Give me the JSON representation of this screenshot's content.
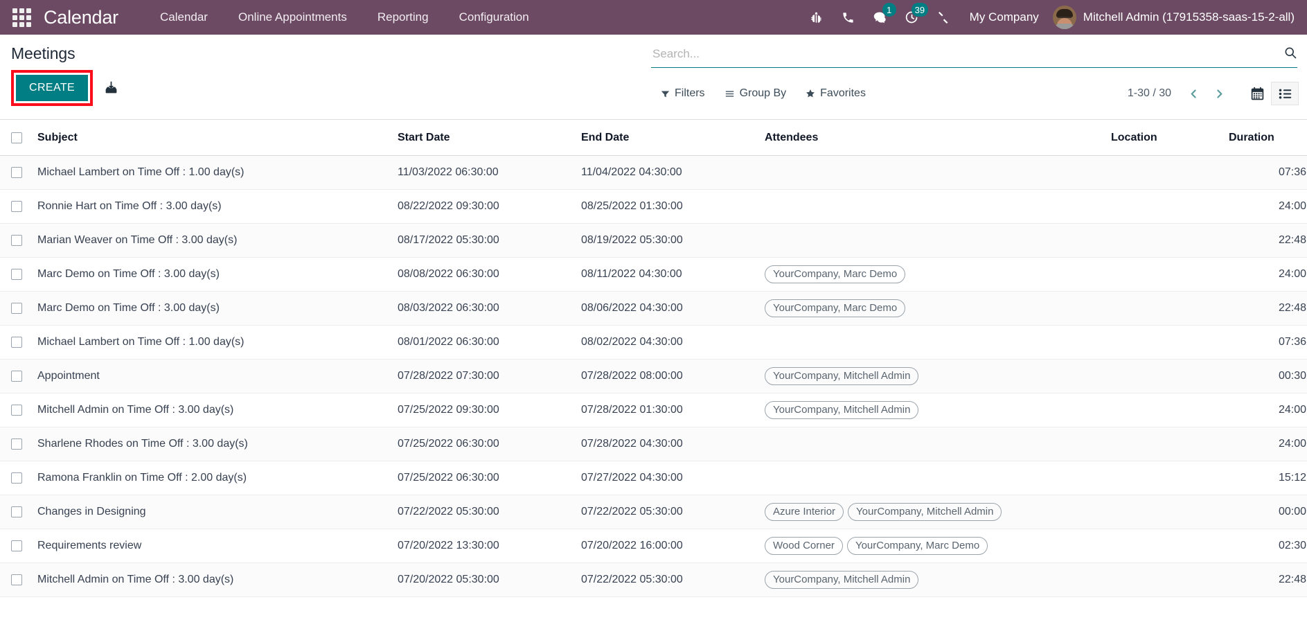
{
  "navbar": {
    "apps_icon": "apps-grid-icon",
    "brand": "Calendar",
    "menu": [
      {
        "label": "Calendar"
      },
      {
        "label": "Online Appointments"
      },
      {
        "label": "Reporting"
      },
      {
        "label": "Configuration"
      }
    ],
    "sys_icons": [
      {
        "name": "bug-icon",
        "badge": ""
      },
      {
        "name": "phone-icon",
        "badge": ""
      },
      {
        "name": "messages-icon",
        "badge": "1"
      },
      {
        "name": "activities-clock-icon",
        "badge": "39"
      },
      {
        "name": "tools-icon",
        "badge": ""
      }
    ],
    "company": "My Company",
    "user": "Mitchell Admin (17915358-saas-15-2-all)",
    "bg_color": "#6c4a63"
  },
  "control_panel": {
    "title": "Meetings",
    "create_label": "CREATE",
    "create_bg": "#017e84",
    "highlight_color": "#fc0d1b",
    "import_icon": "import-download-icon",
    "search": {
      "placeholder": "Search...",
      "value": ""
    },
    "filters": [
      {
        "label": "Filters",
        "icon": "filter-caret-icon"
      },
      {
        "label": "Group By",
        "icon": "group-lines-icon"
      },
      {
        "label": "Favorites",
        "icon": "star-icon"
      }
    ],
    "pager": "1-30 / 30",
    "prev_icon": "chevron-left-icon",
    "next_icon": "chevron-right-icon",
    "views": [
      {
        "name": "calendar-view",
        "icon": "calendar-icon",
        "active": false
      },
      {
        "name": "list-view",
        "icon": "list-icon",
        "active": true
      }
    ]
  },
  "table": {
    "columns": [
      "Subject",
      "Start Date",
      "End Date",
      "Attendees",
      "Location",
      "Duration"
    ],
    "optional_columns_icon": "vertical-dots-icon",
    "rows": [
      {
        "subject": "Michael Lambert on Time Off : 1.00 day(s)",
        "start": "11/03/2022 06:30:00",
        "end": "11/04/2022 04:30:00",
        "attendees": [],
        "location": "",
        "duration": "07:36"
      },
      {
        "subject": "Ronnie Hart on Time Off : 3.00 day(s)",
        "start": "08/22/2022 09:30:00",
        "end": "08/25/2022 01:30:00",
        "attendees": [],
        "location": "",
        "duration": "24:00"
      },
      {
        "subject": "Marian Weaver on Time Off : 3.00 day(s)",
        "start": "08/17/2022 05:30:00",
        "end": "08/19/2022 05:30:00",
        "attendees": [],
        "location": "",
        "duration": "22:48"
      },
      {
        "subject": "Marc Demo on Time Off : 3.00 day(s)",
        "start": "08/08/2022 06:30:00",
        "end": "08/11/2022 04:30:00",
        "attendees": [
          "YourCompany, Marc Demo"
        ],
        "location": "",
        "duration": "24:00"
      },
      {
        "subject": "Marc Demo on Time Off : 3.00 day(s)",
        "start": "08/03/2022 06:30:00",
        "end": "08/06/2022 04:30:00",
        "attendees": [
          "YourCompany, Marc Demo"
        ],
        "location": "",
        "duration": "22:48"
      },
      {
        "subject": "Michael Lambert on Time Off : 1.00 day(s)",
        "start": "08/01/2022 06:30:00",
        "end": "08/02/2022 04:30:00",
        "attendees": [],
        "location": "",
        "duration": "07:36"
      },
      {
        "subject": "Appointment",
        "start": "07/28/2022 07:30:00",
        "end": "07/28/2022 08:00:00",
        "attendees": [
          "YourCompany, Mitchell Admin"
        ],
        "location": "",
        "duration": "00:30"
      },
      {
        "subject": "Mitchell Admin on Time Off : 3.00 day(s)",
        "start": "07/25/2022 09:30:00",
        "end": "07/28/2022 01:30:00",
        "attendees": [
          "YourCompany, Mitchell Admin"
        ],
        "location": "",
        "duration": "24:00"
      },
      {
        "subject": "Sharlene Rhodes on Time Off : 3.00 day(s)",
        "start": "07/25/2022 06:30:00",
        "end": "07/28/2022 04:30:00",
        "attendees": [],
        "location": "",
        "duration": "24:00"
      },
      {
        "subject": "Ramona Franklin on Time Off : 2.00 day(s)",
        "start": "07/25/2022 06:30:00",
        "end": "07/27/2022 04:30:00",
        "attendees": [],
        "location": "",
        "duration": "15:12"
      },
      {
        "subject": "Changes in Designing",
        "start": "07/22/2022 05:30:00",
        "end": "07/22/2022 05:30:00",
        "attendees": [
          "Azure Interior",
          "YourCompany, Mitchell Admin"
        ],
        "location": "",
        "duration": "00:00"
      },
      {
        "subject": "Requirements review",
        "start": "07/20/2022 13:30:00",
        "end": "07/20/2022 16:00:00",
        "attendees": [
          "Wood Corner",
          "YourCompany, Marc Demo"
        ],
        "location": "",
        "duration": "02:30"
      },
      {
        "subject": "Mitchell Admin on Time Off : 3.00 day(s)",
        "start": "07/20/2022 05:30:00",
        "end": "07/22/2022 05:30:00",
        "attendees": [
          "YourCompany, Mitchell Admin"
        ],
        "location": "",
        "duration": "22:48"
      }
    ]
  }
}
